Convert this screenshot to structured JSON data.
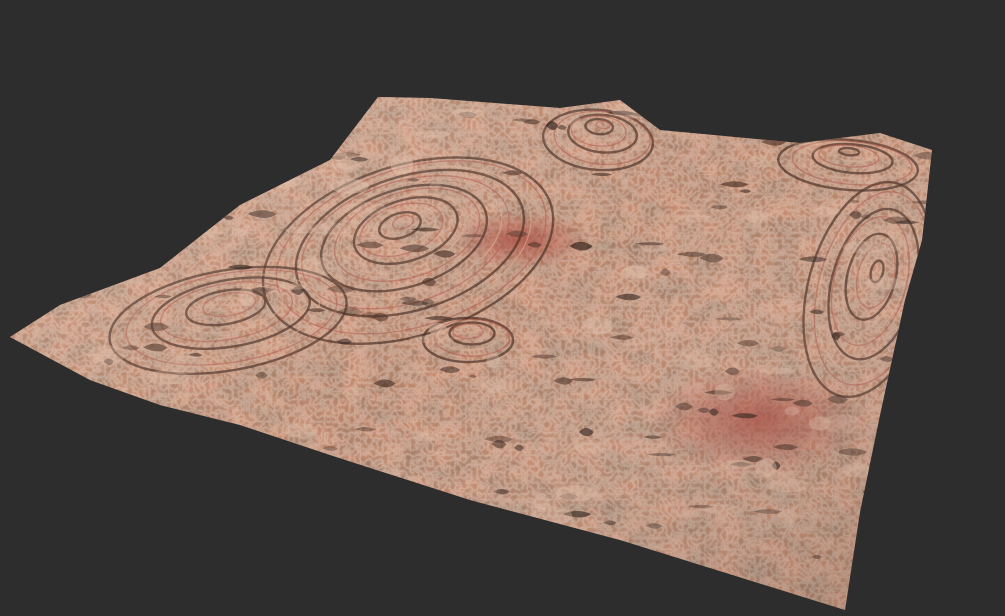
{
  "viewport": {
    "background_color": "#2d2d2d"
  },
  "terrain": {
    "palette": {
      "base": "#c48a6e",
      "light": "#d9b095",
      "pale": "#e3c3ad",
      "rust": "#b0584a",
      "shadow": "#4a2f25",
      "deep_shadow": "#2a1a14"
    }
  }
}
